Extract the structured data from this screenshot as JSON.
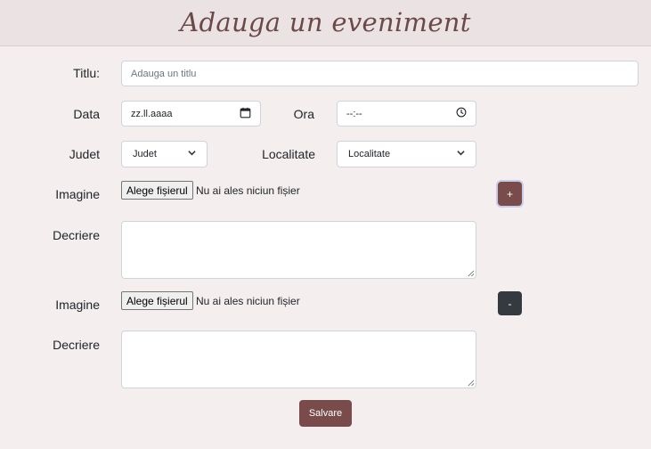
{
  "header": {
    "title": "Adauga un eveniment"
  },
  "form": {
    "title_label": "Titlu:",
    "title_placeholder": "Adauga un titlu",
    "date_label": "Data",
    "date_placeholder": "zz.ll.aaaa",
    "time_label": "Ora",
    "time_placeholder": "--:--",
    "county_label": "Judet",
    "county_value": "Judet",
    "locality_label": "Localitate",
    "locality_value": "Localitate",
    "images": [
      {
        "image_label": "Imagine",
        "file_button": "Alege fișierul",
        "file_status": "Nu ai ales niciun fișier",
        "description_label": "Decriere",
        "action_button": "+"
      },
      {
        "image_label": "Imagine",
        "file_button": "Alege fișierul",
        "file_status": "Nu ai ales niciun fișier",
        "description_label": "Decriere",
        "action_button": "-"
      }
    ],
    "save_button": "Salvare"
  },
  "colors": {
    "page_background": "#f4eeee",
    "header_background": "#ebe3e3",
    "brand": "#7a4b4b",
    "dark_button": "#343a40"
  },
  "icons": [
    "calendar-icon",
    "clock-icon",
    "chevron-down-icon"
  ]
}
